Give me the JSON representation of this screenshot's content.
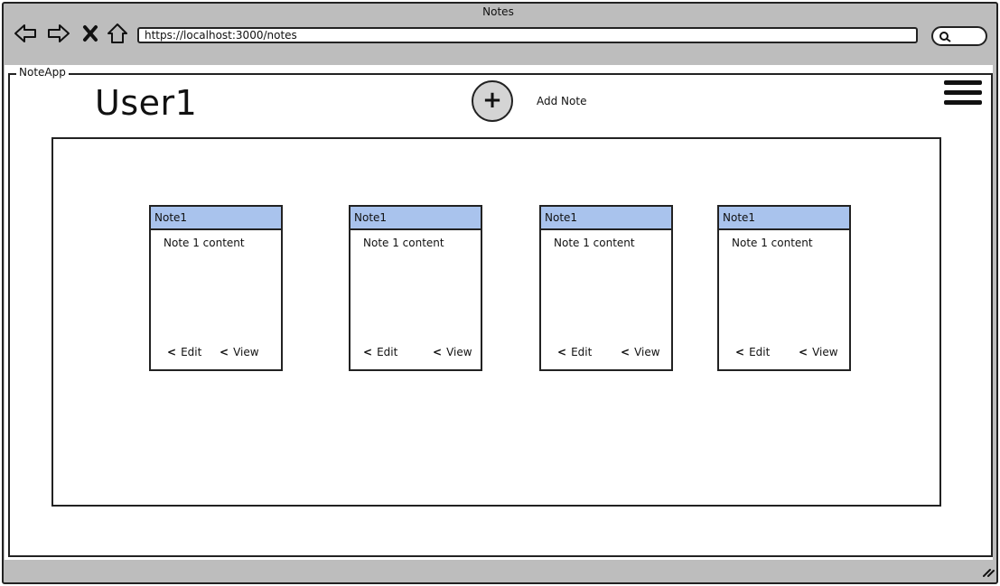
{
  "window": {
    "title": "Notes"
  },
  "toolbar": {
    "back_icon": "arrow-left-icon",
    "forward_icon": "arrow-right-icon",
    "stop_icon": "close-x-icon",
    "home_icon": "home-icon",
    "url": "https://localhost:3000/notes",
    "search_icon": "search-icon"
  },
  "app": {
    "name": "NoteApp"
  },
  "header": {
    "user": "User1",
    "add_label": "Add Note",
    "add_icon": "plus-icon",
    "menu_icon": "hamburger-menu-icon"
  },
  "notes": [
    {
      "title": "Note1",
      "content": "Note 1 content",
      "edit": "Edit",
      "view": "View"
    },
    {
      "title": "Note1",
      "content": "Note 1 content",
      "edit": "Edit",
      "view": "View"
    },
    {
      "title": "Note1",
      "content": "Note 1 content",
      "edit": "Edit",
      "view": "View"
    },
    {
      "title": "Note1",
      "content": "Note 1 content",
      "edit": "Edit",
      "view": "View"
    }
  ],
  "colors": {
    "card_header": "#a9c3ed",
    "chrome": "#bdbdbd",
    "add_button": "#d4d4d4"
  }
}
